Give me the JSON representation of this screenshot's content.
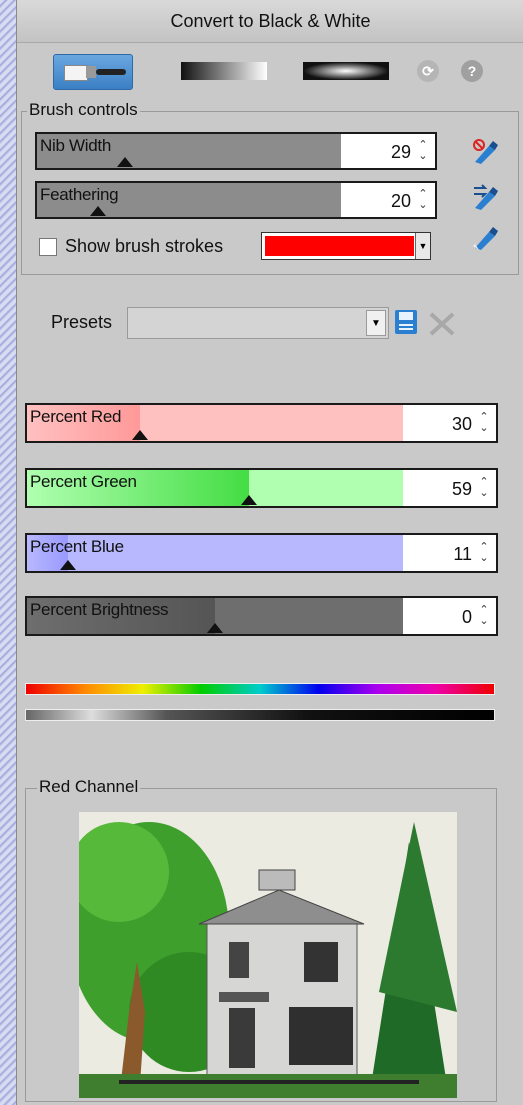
{
  "window": {
    "title": "Convert to Black & White"
  },
  "toolbar": {
    "icons": [
      "brush-icon",
      "linear-gradient-icon",
      "radial-gradient-icon",
      "refresh-icon",
      "help-icon"
    ],
    "help_glyph": "?",
    "refresh_glyph": "⟳"
  },
  "brush_controls": {
    "legend": "Brush controls",
    "nib_width": {
      "label": "Nib Width",
      "value": "29",
      "level": 0.29
    },
    "feathering": {
      "label": "Feathering",
      "value": "20",
      "level": 0.2
    },
    "show_strokes_label": "Show brush strokes",
    "show_strokes_checked": false,
    "stroke_color": "#ff0000",
    "side_icons": [
      "clear-brush-icon",
      "swap-brush-icon",
      "apply-brush-icon"
    ]
  },
  "presets": {
    "label": "Presets",
    "selected": "",
    "icons": [
      "save-icon",
      "delete-icon"
    ]
  },
  "channels": [
    {
      "name": "red",
      "label": "Percent Red",
      "value": "30",
      "level": 0.3,
      "color": "#ff9999",
      "bg": "#ffc0c0"
    },
    {
      "name": "green",
      "label": "Percent Green",
      "value": "59",
      "level": 0.59,
      "color": "#44dd44",
      "bg": "#b0ffb0"
    },
    {
      "name": "blue",
      "label": "Percent Blue",
      "value": "11",
      "level": 0.11,
      "color": "#9999ff",
      "bg": "#b8b8ff"
    },
    {
      "name": "brightness",
      "label": "Percent Brightness",
      "value": "0",
      "level": 0.5,
      "color": "#555555",
      "bg": "#6e6e6e"
    }
  ],
  "preview": {
    "legend": "Red Channel"
  },
  "colors": {
    "accent": "#3b7fc4",
    "panel": "#c9c9c9"
  }
}
